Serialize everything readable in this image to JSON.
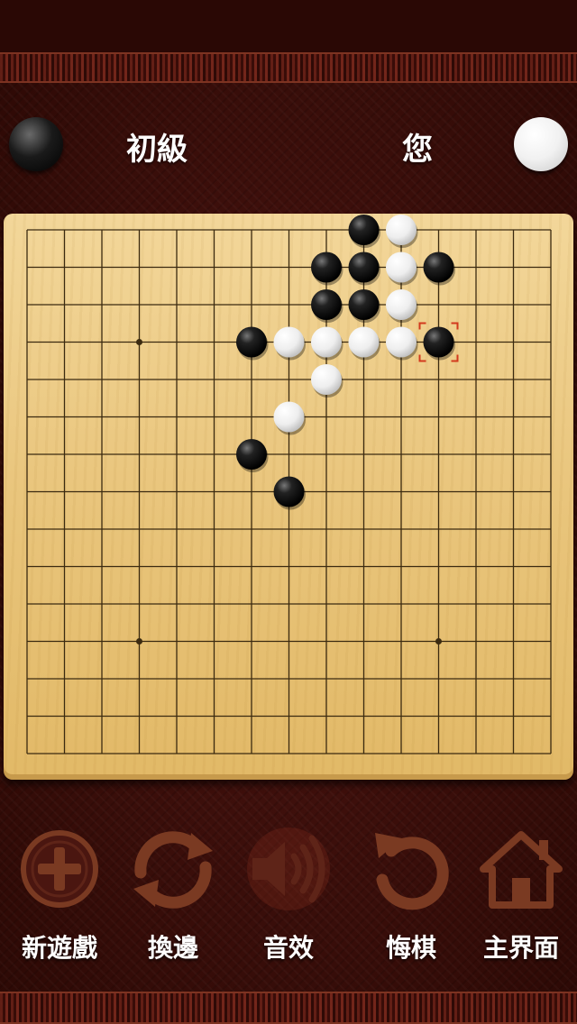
{
  "players": {
    "left": {
      "name": "初級",
      "stone": "black"
    },
    "right": {
      "name": "您",
      "stone": "white"
    }
  },
  "board": {
    "size": 15,
    "star_points": [
      [
        3,
        3
      ],
      [
        11,
        3
      ],
      [
        3,
        11
      ],
      [
        11,
        11
      ]
    ],
    "stones": [
      {
        "col": 9,
        "row": 0,
        "color": "black"
      },
      {
        "col": 10,
        "row": 0,
        "color": "white"
      },
      {
        "col": 8,
        "row": 1,
        "color": "black"
      },
      {
        "col": 9,
        "row": 1,
        "color": "black"
      },
      {
        "col": 10,
        "row": 1,
        "color": "white"
      },
      {
        "col": 11,
        "row": 1,
        "color": "black"
      },
      {
        "col": 8,
        "row": 2,
        "color": "black"
      },
      {
        "col": 9,
        "row": 2,
        "color": "black"
      },
      {
        "col": 10,
        "row": 2,
        "color": "white"
      },
      {
        "col": 6,
        "row": 3,
        "color": "black"
      },
      {
        "col": 7,
        "row": 3,
        "color": "white"
      },
      {
        "col": 8,
        "row": 3,
        "color": "white"
      },
      {
        "col": 9,
        "row": 3,
        "color": "white"
      },
      {
        "col": 10,
        "row": 3,
        "color": "white"
      },
      {
        "col": 11,
        "row": 3,
        "color": "black"
      },
      {
        "col": 8,
        "row": 4,
        "color": "white"
      },
      {
        "col": 7,
        "row": 5,
        "color": "white"
      },
      {
        "col": 6,
        "row": 6,
        "color": "black"
      },
      {
        "col": 7,
        "row": 7,
        "color": "black"
      }
    ],
    "last_move": {
      "col": 11,
      "row": 3
    }
  },
  "toolbar": {
    "new_game": {
      "label": "新遊戲",
      "icon": "plus-circle-icon"
    },
    "switch_sides": {
      "label": "換邊",
      "icon": "swap-arrows-icon"
    },
    "sound": {
      "label": "音效",
      "icon": "speaker-icon"
    },
    "undo": {
      "label": "悔棋",
      "icon": "undo-icon"
    },
    "home": {
      "label": "主界面",
      "icon": "home-icon"
    }
  },
  "colors": {
    "background": "#3a0f0a",
    "board": "#e9c57c",
    "grid_line": "#3b2a10",
    "icon": "#7a3a22",
    "last_move_marker": "#d23a1e"
  }
}
